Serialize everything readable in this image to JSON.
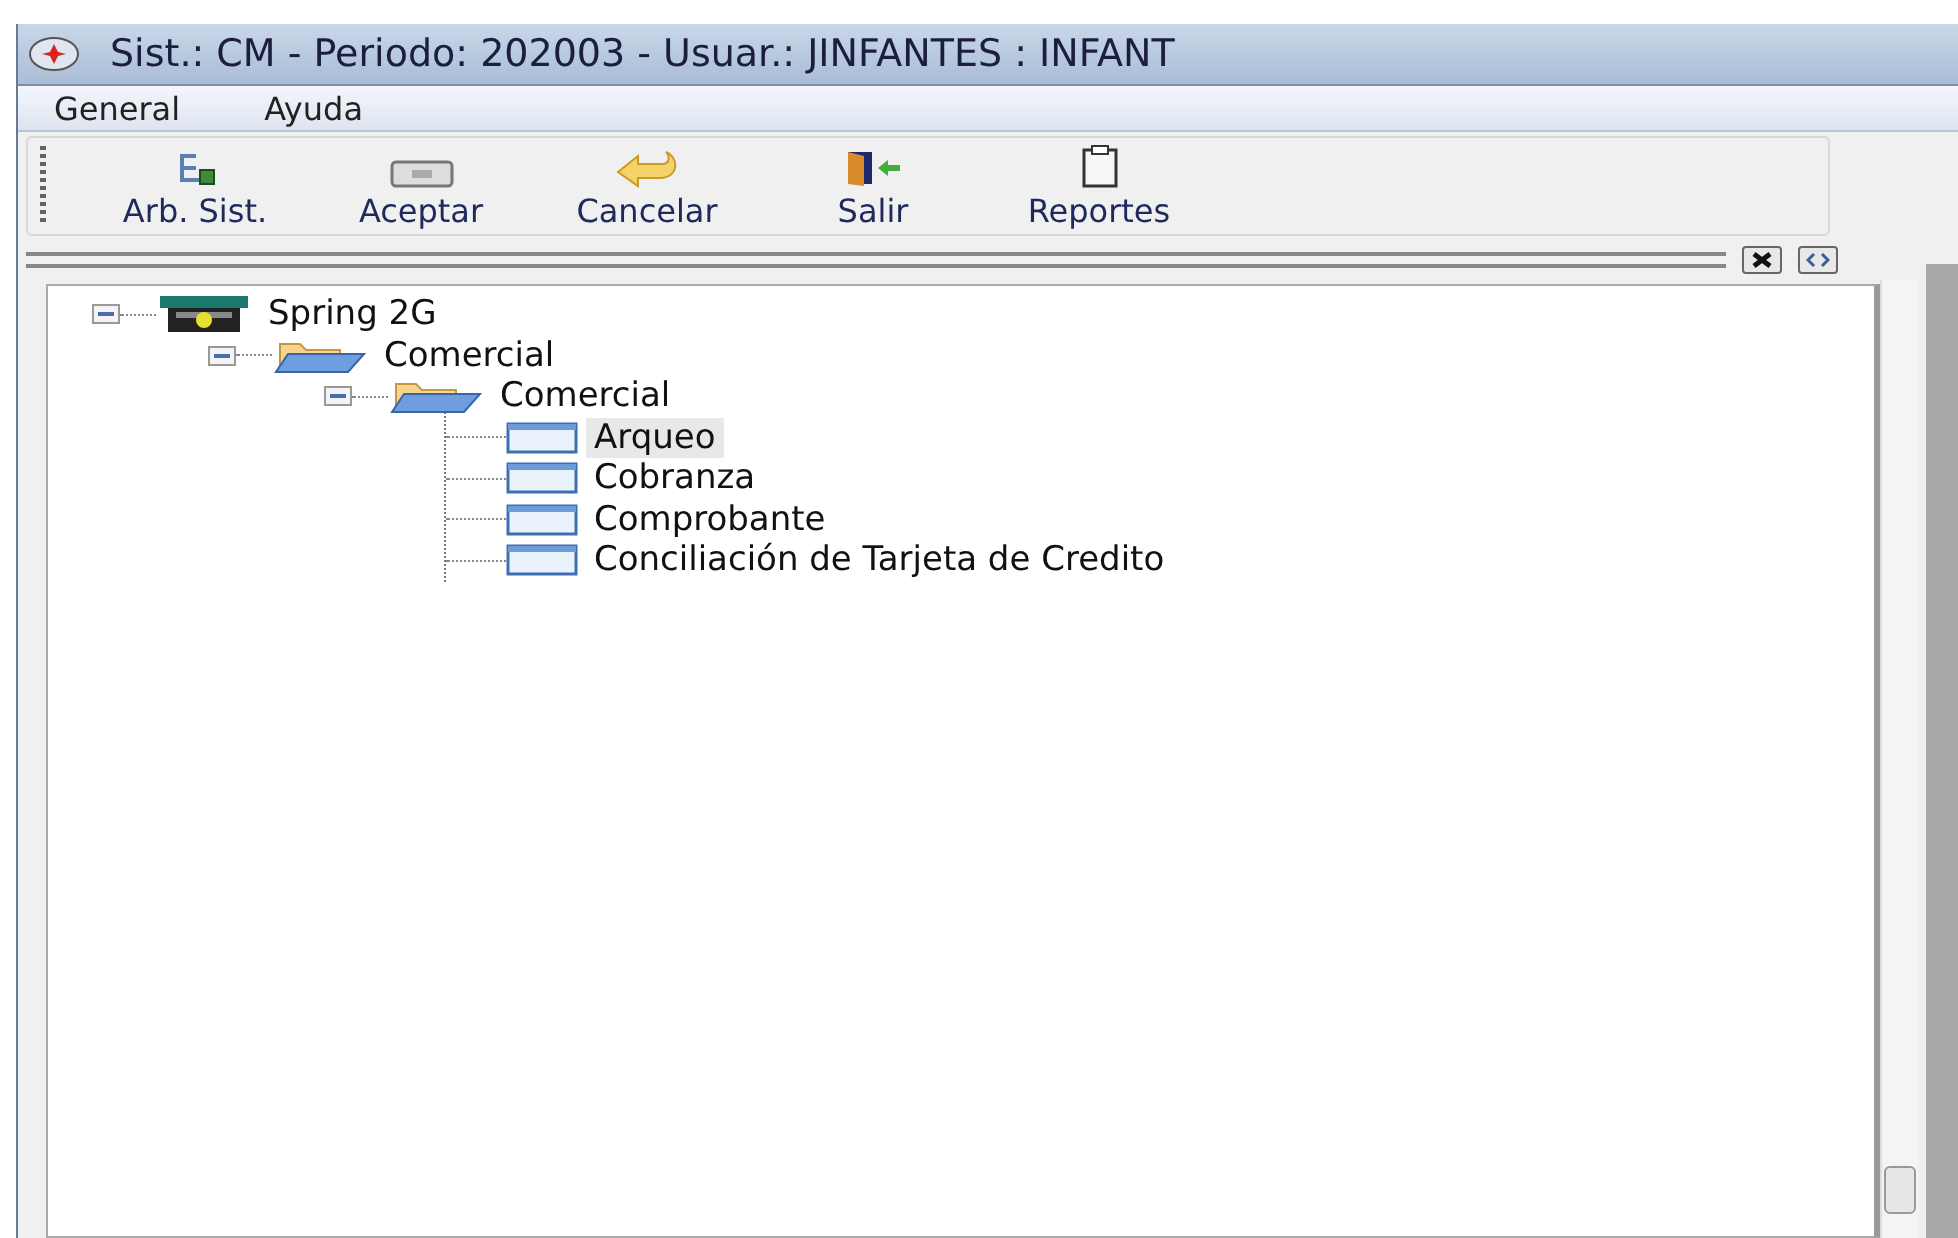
{
  "window": {
    "title": "Sist.: CM - Periodo: 202003 - Usuar.: JINFANTES : INFANT"
  },
  "menu": [
    {
      "label": "General"
    },
    {
      "label": "Ayuda"
    }
  ],
  "toolbar": [
    {
      "label": "Arb. Sist.",
      "kind": "tree"
    },
    {
      "label": "Aceptar",
      "kind": "ok"
    },
    {
      "label": "Cancelar",
      "kind": "cancel"
    },
    {
      "label": "Salir",
      "kind": "exit"
    },
    {
      "label": "Reportes",
      "kind": "report"
    }
  ],
  "tree": {
    "items": [
      {
        "label": "Spring 2G",
        "kind": "system",
        "expanded": true,
        "selected": false,
        "children": [
          {
            "label": "Comercial",
            "kind": "folder",
            "expanded": true,
            "selected": false,
            "children": [
              {
                "label": "Comercial",
                "kind": "folder",
                "expanded": true,
                "selected": false,
                "children": [
                  {
                    "label": "Arqueo",
                    "kind": "form",
                    "selected": true
                  },
                  {
                    "label": "Cobranza",
                    "kind": "form",
                    "selected": false
                  },
                  {
                    "label": "Comprobante",
                    "kind": "form",
                    "selected": false
                  },
                  {
                    "label": "Conciliación de Tarjeta de Credito",
                    "kind": "form",
                    "selected": false
                  }
                ]
              }
            ]
          }
        ]
      }
    ]
  }
}
